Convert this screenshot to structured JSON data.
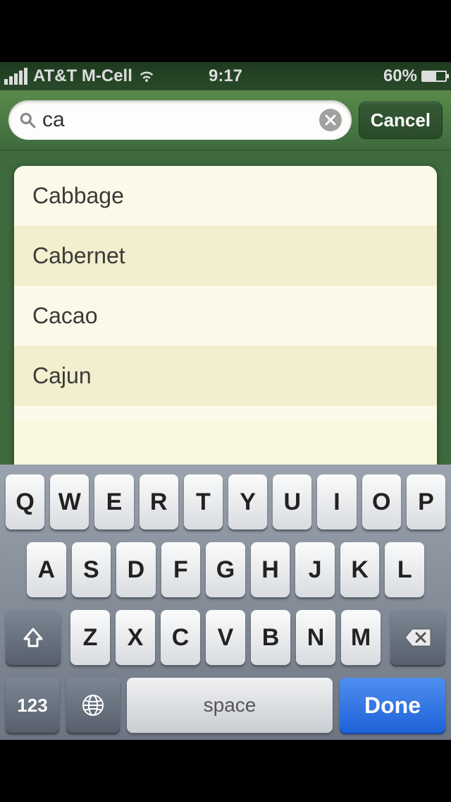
{
  "status": {
    "carrier": "AT&T M-Cell",
    "time": "9:17",
    "battery_pct_text": "60%",
    "battery_pct": 60
  },
  "search": {
    "query": "ca",
    "cancel_label": "Cancel"
  },
  "results": [
    "Cabbage",
    "Cabernet",
    "Cacao",
    "Cajun"
  ],
  "keyboard": {
    "row1": [
      "Q",
      "W",
      "E",
      "R",
      "T",
      "Y",
      "U",
      "I",
      "O",
      "P"
    ],
    "row2": [
      "A",
      "S",
      "D",
      "F",
      "G",
      "H",
      "J",
      "K",
      "L"
    ],
    "row3": [
      "Z",
      "X",
      "C",
      "V",
      "B",
      "N",
      "M"
    ],
    "numbers_label": "123",
    "space_label": "space",
    "done_label": "Done"
  }
}
